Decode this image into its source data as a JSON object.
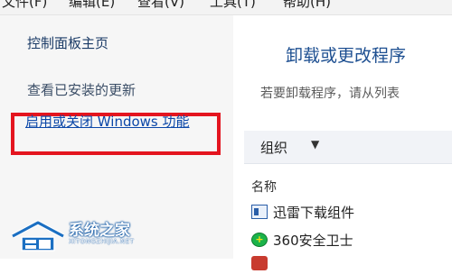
{
  "menubar": {
    "items": [
      "文件(F)",
      "编辑(E)",
      "查看(V)",
      "工具(T)",
      "帮助(H)"
    ]
  },
  "sidebar": {
    "home_link": "控制面板主页",
    "updates_link": "查看已安装的更新",
    "features_link": "启用或关闭 Windows 功能",
    "highlight_color": "#e4151f"
  },
  "main": {
    "title": "卸载或更改程序",
    "description": "若要卸载程序，请从列表",
    "toolbar": {
      "organize_label": "组织",
      "organize_caret": "▼"
    },
    "list": {
      "column_header": "名称",
      "programs": [
        {
          "name": "迅雷下载组件",
          "icon": "xunlei-icon"
        },
        {
          "name": "360安全卫士",
          "icon": "360-shield-icon",
          "icon_glyph": "+"
        },
        {
          "name": "",
          "icon": "app-icon"
        }
      ]
    }
  },
  "watermark": {
    "title": "系统之家",
    "subtitle": "XITONGZHIJIA.NET"
  },
  "colors": {
    "link": "#0b47a8",
    "title": "#1d4f91"
  }
}
